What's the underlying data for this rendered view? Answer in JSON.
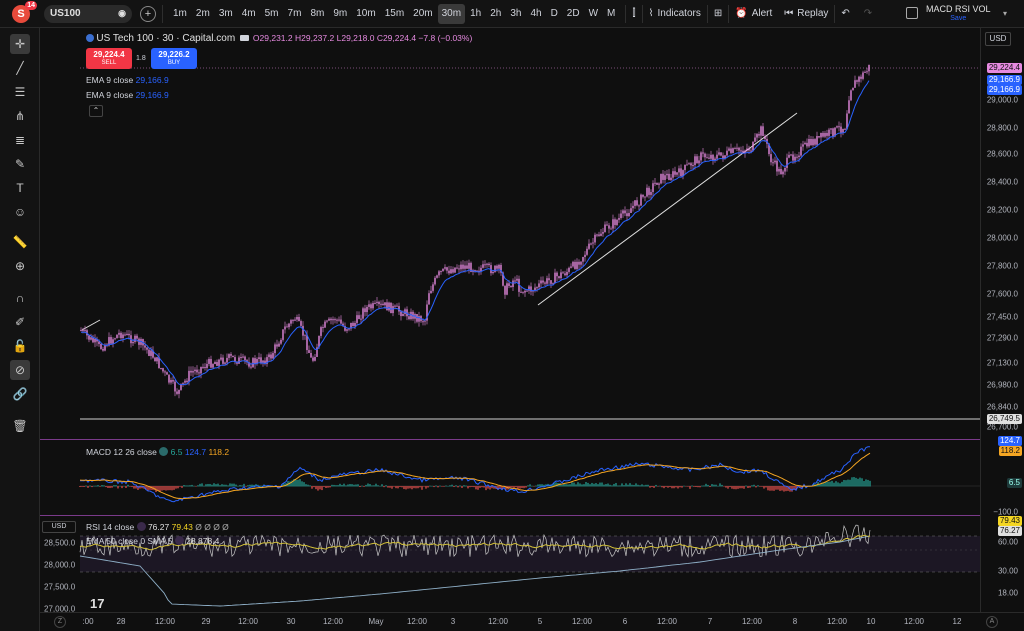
{
  "topbar": {
    "logo_letter": "S",
    "badge_count": "14",
    "symbol": "US100",
    "timeframes": [
      "1m",
      "2m",
      "3m",
      "4m",
      "5m",
      "7m",
      "8m",
      "9m",
      "10m",
      "15m",
      "20m",
      "30m",
      "1h",
      "2h",
      "3h",
      "4h",
      "D",
      "2D",
      "W",
      "M"
    ],
    "active_timeframe": "30m",
    "indicators_label": "Indicators",
    "alert_label": "Alert",
    "replay_label": "Replay",
    "layout_name": "MACD RSI VOL",
    "save_label": "Save"
  },
  "chart": {
    "title": "US Tech 100 · 30 · Capital.com",
    "ohlc": {
      "o": "29,231.2",
      "h": "29,237.2",
      "l": "29,218.0",
      "c": "29,224.4",
      "chg": "−7.8 (−0.03%)"
    },
    "sell_price": "29,224.4",
    "sell_label": "SELL",
    "spread": "1.8",
    "buy_price": "29,226.2",
    "buy_label": "BUY",
    "ema1_label": "EMA 9 close",
    "ema1_value": "29,166.9",
    "ema2_label": "EMA 9 close",
    "ema2_value": "29,166.9",
    "currency": "USD",
    "price_labels": [
      "29,000.0",
      "28,800.0",
      "28,600.0",
      "28,400.0",
      "28,200.0",
      "28,000.0",
      "27,800.0",
      "27,600.0",
      "27,450.0",
      "27,290.0",
      "27,130.0",
      "26,980.0",
      "26,840.0",
      "26,700.0"
    ],
    "price_tag": "29,224.4",
    "ema_tag_1": "29,166.9",
    "ema_tag_2": "29,166.9",
    "hline_tag": "26,749.5"
  },
  "macd": {
    "label": "MACD 12 26 close",
    "v1": "6.5",
    "v2": "124.7",
    "v3": "118.2",
    "tag_top": "124.7",
    "tag_mid": "118.2",
    "tag_hist": "6.5",
    "low_label": "−100.0"
  },
  "rsi": {
    "currency": "USD",
    "label": "RSI 14 close",
    "v1": "76.27",
    "v2": "79.43",
    "zeros": "Ø Ø Ø Ø",
    "ema_label": "EMA 50 close 0 SMA 5",
    "ema_value": "28,878.4",
    "left_prices": [
      "28,500.0",
      "28,000.0",
      "27,500.0",
      "27,000.0"
    ],
    "tag1": "79.43",
    "tag2": "76.27",
    "levels": [
      "60.00",
      "30.00",
      "18.00"
    ]
  },
  "xaxis": {
    "labels": [
      ":00",
      "28",
      "12:00",
      "29",
      "12:00",
      "30",
      "12:00",
      "May",
      "12:00",
      "3",
      "12:00",
      "5",
      "12:00",
      "6",
      "12:00",
      "7",
      "12:00",
      "8",
      "12:00",
      "10",
      "12:00",
      "12"
    ]
  },
  "colors": {
    "sell": "#f23645",
    "buy": "#2962ff",
    "candle": "#e68ae0",
    "ema": "#2962ff",
    "macd": "#2962ff",
    "signal": "#f5a623"
  }
}
